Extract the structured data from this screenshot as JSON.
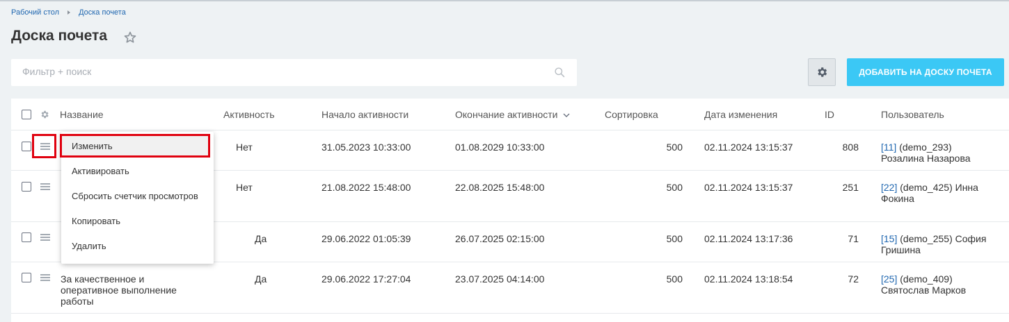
{
  "breadcrumb": {
    "items": [
      "Рабочий стол",
      "Доска почета"
    ]
  },
  "page": {
    "title": "Доска почета"
  },
  "filter": {
    "placeholder": "Фильтр + поиск"
  },
  "toolbar": {
    "add_label": "ДОБАВИТЬ НА ДОСКУ ПОЧЕТА"
  },
  "table": {
    "headers": {
      "name": "Название",
      "active": "Активность",
      "start": "Начало активности",
      "end": "Окончание активности",
      "sort": "Сортировка",
      "modified": "Дата изменения",
      "id": "ID",
      "user": "Пользователь"
    },
    "rows": [
      {
        "name": "",
        "active": "Нет",
        "start": "31.05.2023 10:33:00",
        "end": "01.08.2029 10:33:00",
        "sort": "500",
        "modified": "02.11.2024 13:15:37",
        "id": "808",
        "user_id": "[11]",
        "user_rest": " (demo_293)",
        "user_line2": "Розалина Назарова"
      },
      {
        "name": "",
        "active": "Нет",
        "start": "21.08.2022 15:48:00",
        "end": "22.08.2025 15:48:00",
        "sort": "500",
        "modified": "02.11.2024 13:15:37",
        "id": "251",
        "user_id": "[22]",
        "user_rest": " (demo_425) Инна",
        "user_line2": "Фокина"
      },
      {
        "name": "",
        "active": "Да",
        "start": "29.06.2022 01:05:39",
        "end": "26.07.2025 02:15:00",
        "sort": "500",
        "modified": "02.11.2024 13:17:36",
        "id": "71",
        "user_id": "[15]",
        "user_rest": " (demo_255) София",
        "user_line2": "Гришина"
      },
      {
        "name_lines": [
          "За качественное и",
          "оперативное выполнение",
          "работы"
        ],
        "active": "Да",
        "start": "29.06.2022 17:27:04",
        "end": "23.07.2025 04:14:00",
        "sort": "500",
        "modified": "02.11.2024 13:18:54",
        "id": "72",
        "user_id": "[25]",
        "user_rest": " (demo_409)",
        "user_line2": "Святослав Марков"
      }
    ]
  },
  "context_menu": {
    "items": [
      "Изменить",
      "Активировать",
      "Сбросить счетчик просмотров",
      "Копировать",
      "Удалить"
    ]
  },
  "colors": {
    "accent": "#3bc8f5",
    "link": "#2067b0",
    "highlight": "#e0010f",
    "background": "#eef2f4"
  }
}
